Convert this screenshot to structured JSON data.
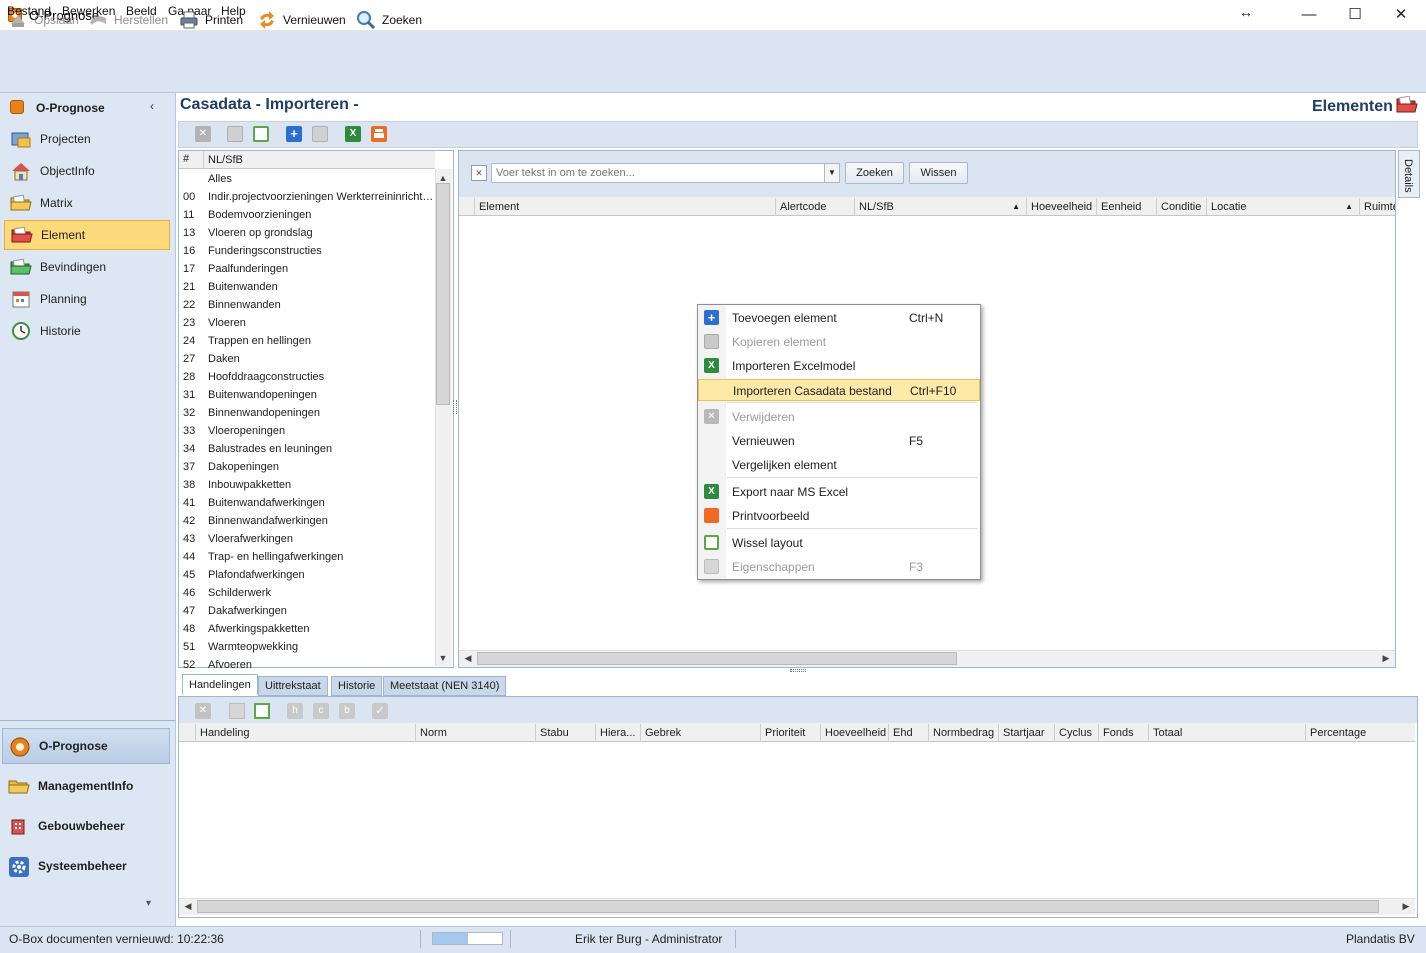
{
  "window": {
    "title": "O-Prognose",
    "minimize": "—",
    "maximize": "☐",
    "close": "✕",
    "resize_glyph": "↔"
  },
  "menu": [
    "Bestand",
    "Bewerken",
    "Beeld",
    "Ga naar",
    "Help"
  ],
  "toolbar": {
    "save": "Opslaan",
    "restore": "Herstellen",
    "print": "Printen",
    "refresh": "Vernieuwen",
    "search": "Zoeken"
  },
  "nav": {
    "title": "O-Prognose",
    "collapse": "‹",
    "items": [
      {
        "label": "Projecten",
        "icon": "projects-icon"
      },
      {
        "label": "ObjectInfo",
        "icon": "house-icon"
      },
      {
        "label": "Matrix",
        "icon": "folder-icon"
      },
      {
        "label": "Element",
        "icon": "red-folder-icon"
      },
      {
        "label": "Bevindingen",
        "icon": "green-folder-icon"
      },
      {
        "label": "Planning",
        "icon": "calendar-icon"
      },
      {
        "label": "Historie",
        "icon": "history-icon"
      }
    ],
    "modules": [
      {
        "label": "O-Prognose",
        "icon": "oprognose-icon"
      },
      {
        "label": "ManagementInfo",
        "icon": "folder-icon"
      },
      {
        "label": "Gebouwbeheer",
        "icon": "building-icon"
      },
      {
        "label": "Systeembeheer",
        "icon": "gear-icon"
      }
    ],
    "more": "▾"
  },
  "main": {
    "title": "Casadata - Importeren -",
    "section": "Elementen"
  },
  "tree": {
    "headers": [
      "#",
      "NL/SfB"
    ],
    "rows": [
      {
        "code": "",
        "label": "Alles"
      },
      {
        "code": "00",
        "label": "Indir.projectvoorzieningen Werkterreininrichting"
      },
      {
        "code": "11",
        "label": "Bodemvoorzieningen"
      },
      {
        "code": "13",
        "label": "Vloeren op grondslag"
      },
      {
        "code": "16",
        "label": "Funderingsconstructies"
      },
      {
        "code": "17",
        "label": "Paalfunderingen"
      },
      {
        "code": "21",
        "label": "Buitenwanden"
      },
      {
        "code": "22",
        "label": "Binnenwanden"
      },
      {
        "code": "23",
        "label": "Vloeren"
      },
      {
        "code": "24",
        "label": "Trappen en hellingen"
      },
      {
        "code": "27",
        "label": "Daken"
      },
      {
        "code": "28",
        "label": "Hoofddraagconstructies"
      },
      {
        "code": "31",
        "label": "Buitenwandopeningen"
      },
      {
        "code": "32",
        "label": "Binnenwandopeningen"
      },
      {
        "code": "33",
        "label": "Vloeropeningen"
      },
      {
        "code": "34",
        "label": "Balustrades en leuningen"
      },
      {
        "code": "37",
        "label": "Dakopeningen"
      },
      {
        "code": "38",
        "label": "Inbouwpakketten"
      },
      {
        "code": "41",
        "label": "Buitenwandafwerkingen"
      },
      {
        "code": "42",
        "label": "Binnenwandafwerkingen"
      },
      {
        "code": "43",
        "label": "Vloerafwerkingen"
      },
      {
        "code": "44",
        "label": "Trap- en hellingafwerkingen"
      },
      {
        "code": "45",
        "label": "Plafondafwerkingen"
      },
      {
        "code": "46",
        "label": "Schilderwerk"
      },
      {
        "code": "47",
        "label": "Dakafwerkingen"
      },
      {
        "code": "48",
        "label": "Afwerkingspakketten"
      },
      {
        "code": "51",
        "label": "Warmteopwekking"
      },
      {
        "code": "52",
        "label": "Afvoeren"
      }
    ]
  },
  "search": {
    "placeholder": "Voer tekst in om te zoeken...",
    "clear": "✕",
    "dropdown": "▼",
    "search_btn": "Zoeken",
    "clear_btn": "Wissen"
  },
  "grid": {
    "columns": [
      "Element",
      "Alertcode",
      "NL/SfB",
      "Hoeveelheid",
      "Eenheid",
      "Conditie",
      "Locatie",
      "Ruimte"
    ],
    "sort_asc": "▲"
  },
  "details_tab": "Details",
  "context_menu": [
    {
      "label": "Toevoegen element",
      "shortcut": "Ctrl+N",
      "icon": "add-icon",
      "disabled": false
    },
    {
      "label": "Kopieren element",
      "shortcut": "",
      "icon": "copy-icon",
      "disabled": true
    },
    {
      "label": "Importeren Excelmodel",
      "shortcut": "",
      "icon": "excel-icon",
      "disabled": false
    },
    {
      "label": "Importeren Casadata bestand",
      "shortcut": "Ctrl+F10",
      "icon": "",
      "disabled": false
    },
    {
      "label": "Verwijderen",
      "shortcut": "",
      "icon": "delete-icon",
      "disabled": true
    },
    {
      "label": "Vernieuwen",
      "shortcut": "F5",
      "icon": "",
      "disabled": false
    },
    {
      "label": "Vergelijken element",
      "shortcut": "",
      "icon": "",
      "disabled": false
    },
    {
      "label": "Export naar MS Excel",
      "shortcut": "",
      "icon": "excel-icon",
      "disabled": false
    },
    {
      "label": "Printvoorbeeld",
      "shortcut": "",
      "icon": "print-icon",
      "disabled": false
    },
    {
      "label": "Wissel layout",
      "shortcut": "",
      "icon": "layout-icon",
      "disabled": false
    },
    {
      "label": "Eigenschappen",
      "shortcut": "F3",
      "icon": "properties-icon",
      "disabled": true
    }
  ],
  "bottom": {
    "tabs": [
      "Handelingen",
      "Uittrekstaat",
      "Historie",
      "Meetstaat (NEN 3140)"
    ],
    "columns": [
      "Handeling",
      "Norm",
      "Stabu",
      "Hiera...",
      "Gebrek",
      "Prioriteit",
      "Hoeveelheid",
      "Ehd",
      "Normbedrag",
      "Startjaar",
      "Cyclus",
      "Fonds",
      "Totaal",
      "Percentage"
    ]
  },
  "status": {
    "left": "O-Box documenten vernieuwd: 10:22:36",
    "user": "Erik ter Burg - Administrator",
    "company": "Plandatis BV",
    "progress": 0.5
  },
  "colors": {
    "accent": "#1f3e66",
    "selected": "#fdda7c",
    "chrome": "#dbe5f1"
  }
}
